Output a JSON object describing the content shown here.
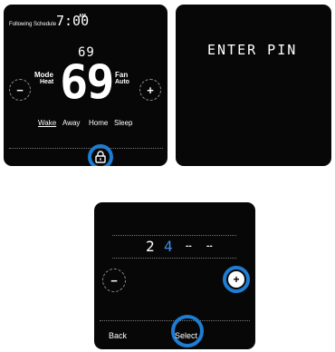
{
  "main_screen": {
    "status": "Following Schedule",
    "time": "7:00",
    "am_pm": "AM",
    "setpoint": "69",
    "current_temp": "69",
    "mode_label": "Mode",
    "mode_value": "Heat",
    "fan_label": "Fan",
    "fan_value": "Auto",
    "decrease": "−",
    "increase": "+",
    "periods": [
      "Wake",
      "Away",
      "Home",
      "Sleep"
    ],
    "selected_period": "Wake",
    "lock_icon": "lock-icon"
  },
  "pin_prompt": {
    "text": "ENTER PIN"
  },
  "pin_entry": {
    "digits": [
      "2",
      "4",
      "--",
      "--"
    ],
    "decrease": "−",
    "increase": "+",
    "back_label": "Back",
    "select_label": "Select"
  },
  "colors": {
    "highlight": "#1e7dd3",
    "active_digit": "#3a8ee6",
    "screen_bg": "#070707"
  }
}
